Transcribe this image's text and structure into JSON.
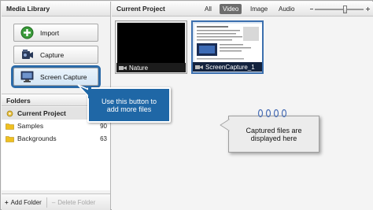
{
  "left_panel": {
    "header": "Media Library",
    "buttons": [
      {
        "label": "Import",
        "icon": "import-icon"
      },
      {
        "label": "Capture",
        "icon": "camcorder-icon"
      },
      {
        "label": "Screen Capture",
        "icon": "monitor-icon"
      }
    ],
    "folders_header": "Folders",
    "folders": [
      {
        "name": "Current Project",
        "count": "",
        "icon": "project-icon"
      },
      {
        "name": "Samples",
        "count": "90",
        "icon": "folder-icon"
      },
      {
        "name": "Backgrounds",
        "count": "63",
        "icon": "folder-icon"
      }
    ],
    "add_folder": "Add Folder",
    "delete_folder": "Delete Folder"
  },
  "right_panel": {
    "title": "Current Project",
    "filters": [
      "All",
      "Video",
      "Image",
      "Audio"
    ],
    "active_filter": "Video",
    "thumbnail_size_level": 0.55,
    "items": [
      {
        "name": "Nature",
        "type": "video"
      },
      {
        "name": "ScreenCapture_1",
        "type": "video"
      }
    ]
  },
  "callouts": {
    "screen_capture_line1": "Use this button to",
    "screen_capture_line2": "add more files",
    "captured_line1": "Captured files are",
    "captured_line2": "displayed here"
  },
  "colors": {
    "accent_blue": "#1f67a6",
    "selection_border": "#3b6fae",
    "active_tab": "#6d6d6d",
    "folder_yellow": "#f0c020",
    "import_green": "#3a9a3a"
  }
}
